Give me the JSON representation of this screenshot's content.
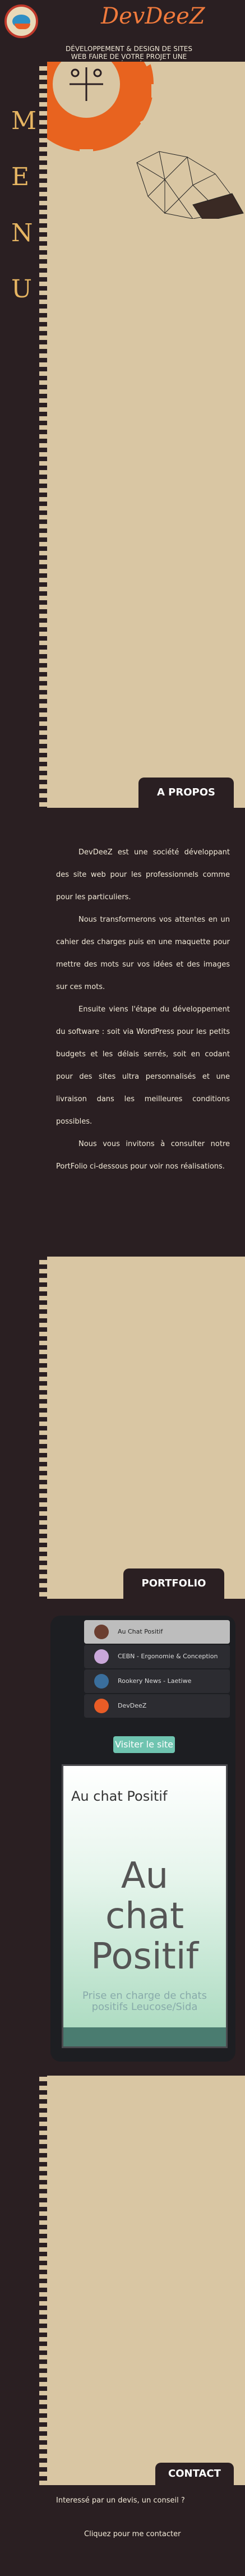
{
  "header": {
    "brand": "DevDeeZ",
    "tagline": "DÉVELOPPEMENT & DESIGN DE SITES WEB FAIRE DE VOTRE PROJET UNE RÉALITÉ"
  },
  "menu": {
    "letters": [
      "M",
      "E",
      "N",
      "U"
    ]
  },
  "about": {
    "title": "A PROPOS",
    "paragraphs": [
      "DevDeeZ est une société développant des site web pour les professionnels comme pour les particuliers.",
      "Nous transformerons vos attentes en un cahier des charges puis en une maquette pour mettre des mots sur vos idées et des images sur ces mots.",
      "Ensuite viens l'étape du développement du software : soit via WordPress pour les petits budgets et les délais serrés, soit en codant pour des sites ultra personnalisés et une livraison dans les meilleures conditions possibles.",
      "Nous vous invitons à consulter notre PortFolio ci-dessous pour voir nos réalisations."
    ]
  },
  "portfolio": {
    "title": "PORTFOLIO",
    "items": [
      "Au Chat Positif",
      "CEBN - Ergonomie & Conception",
      "Rookery News - Laetiwe",
      "DevDeeZ"
    ],
    "visit_label": "Visiter le site",
    "preview": {
      "small_title": "Au chat Positif",
      "big_line1": "Au",
      "big_line2": "chat",
      "big_line3": "Positif",
      "sub_line1": "Prise en charge de chats",
      "sub_line2": "positifs Leucose/Sida"
    }
  },
  "contact": {
    "title": "CONTACT",
    "question": "Interessé par un devis, un conseil ?",
    "link": "Cliquez pour me contacter"
  },
  "colors": {
    "dark": "#2a1f22",
    "sand": "#d9c6a3",
    "accent": "#f07a3c",
    "menu": "#e6b562"
  }
}
